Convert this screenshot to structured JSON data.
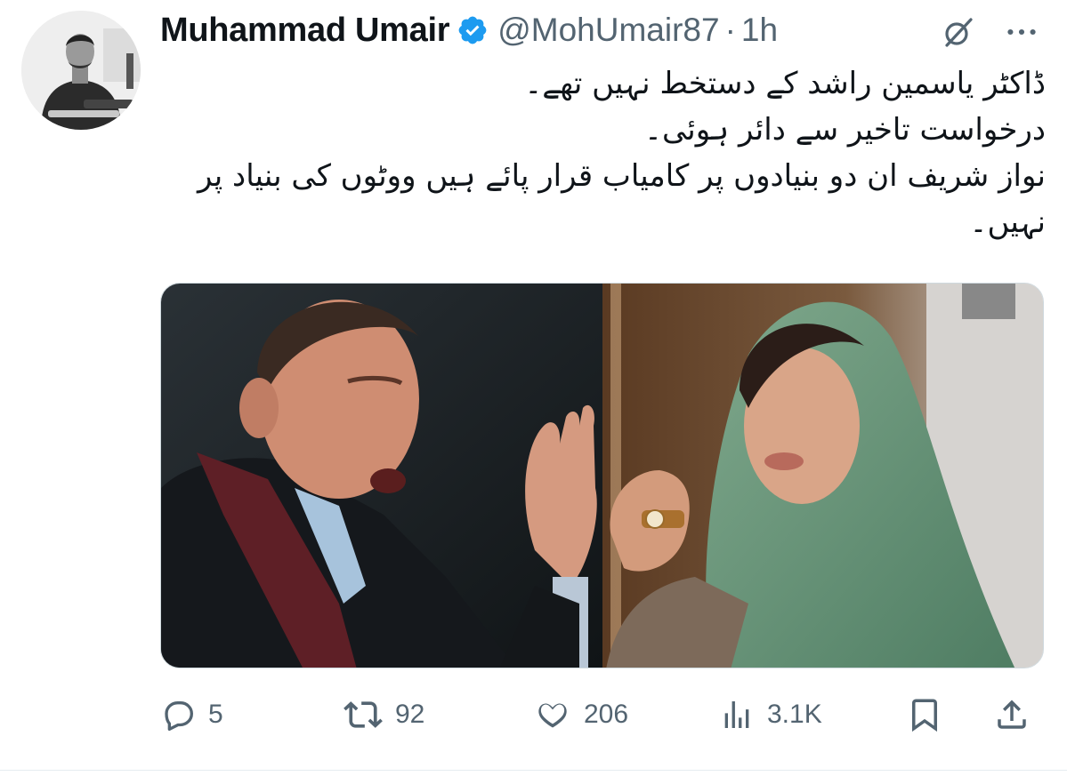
{
  "author": {
    "display_name": "Muhammad Umair",
    "handle": "@MohUmair87",
    "separator": "·",
    "timestamp": "1h",
    "verified": true,
    "avatar_icon": "avatar-photo"
  },
  "tweet": {
    "lines": [
      "ڈاکٹر یاسمین راشد کے دستخط نہیں تھے۔",
      "درخواست تاخیر سے دائر ہوئی۔",
      "نواز شریف ان دو بنیادوں پر کامیاب قرار پائے ہیں ووٹوں کی بنیاد پر نہیں۔"
    ],
    "media_description_icon": "photo-collage"
  },
  "actions": {
    "reply_count": "5",
    "retweet_count": "92",
    "like_count": "206",
    "view_count": "3.1K"
  },
  "icons": {
    "grok": "grok-icon",
    "more": "more-icon",
    "reply": "reply-icon",
    "retweet": "retweet-icon",
    "like": "heart-icon",
    "views": "views-icon",
    "bookmark": "bookmark-icon",
    "share": "share-icon",
    "verified": "verified-badge-icon"
  },
  "colors": {
    "text_primary": "#0f1419",
    "text_secondary": "#536471",
    "verified_blue": "#1d9bf0",
    "border": "#cfd9de"
  }
}
